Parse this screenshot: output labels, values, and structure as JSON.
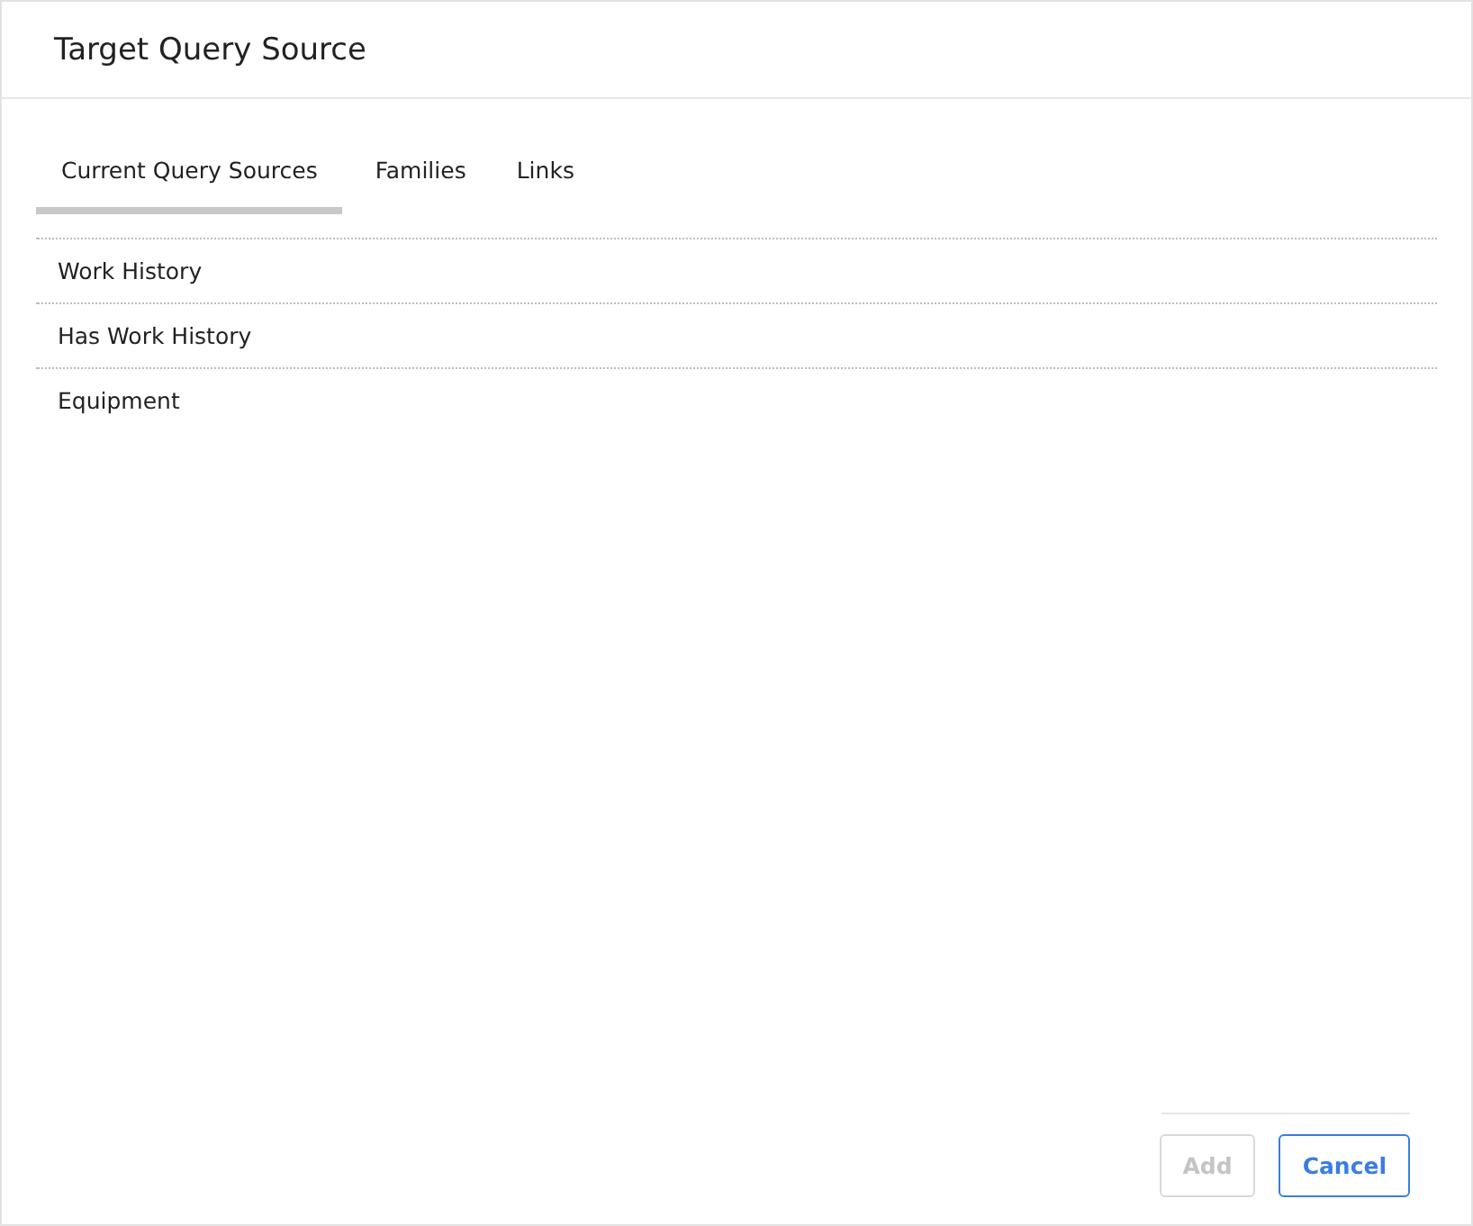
{
  "dialog": {
    "title": "Target Query Source"
  },
  "tabs": [
    {
      "label": "Current Query Sources",
      "selected": true
    },
    {
      "label": "Families",
      "selected": false
    },
    {
      "label": "Links",
      "selected": false
    }
  ],
  "items": [
    "Work History",
    "Has Work History",
    "Equipment"
  ],
  "buttons": [
    {
      "label": "Add",
      "disabled": true
    },
    {
      "label": "Cancel",
      "disabled": false
    }
  ]
}
